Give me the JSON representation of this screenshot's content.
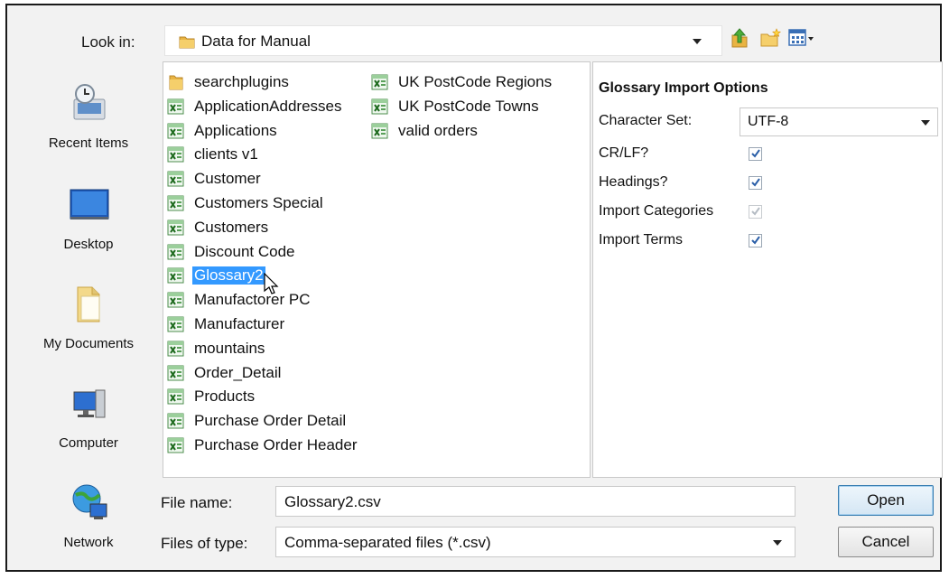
{
  "lookin": {
    "label": "Look in:",
    "value": "Data for Manual"
  },
  "toolbar": {
    "up_icon": "up-folder-icon",
    "new_icon": "new-folder-icon",
    "view_icon": "view-menu-icon"
  },
  "places": [
    {
      "label": "Recent Items",
      "icon": "recent-items-icon"
    },
    {
      "label": "Desktop",
      "icon": "desktop-icon"
    },
    {
      "label": "My Documents",
      "icon": "my-documents-icon"
    },
    {
      "label": "Computer",
      "icon": "computer-icon"
    },
    {
      "label": "Network",
      "icon": "network-icon"
    }
  ],
  "files": {
    "column1": [
      {
        "name": "searchplugins",
        "type": "folder"
      },
      {
        "name": "ApplicationAddresses",
        "type": "csv"
      },
      {
        "name": "Applications",
        "type": "csv"
      },
      {
        "name": "clients v1",
        "type": "csv"
      },
      {
        "name": "Customer",
        "type": "csv"
      },
      {
        "name": "Customers Special",
        "type": "csv"
      },
      {
        "name": "Customers",
        "type": "csv"
      },
      {
        "name": "Discount Code",
        "type": "csv"
      },
      {
        "name": "Glossary2",
        "type": "csv",
        "selected": true
      },
      {
        "name": "Manufactorer PC",
        "type": "csv"
      },
      {
        "name": "Manufacturer",
        "type": "csv"
      },
      {
        "name": "mountains",
        "type": "csv"
      },
      {
        "name": "Order_Detail",
        "type": "csv"
      },
      {
        "name": "Products",
        "type": "csv"
      },
      {
        "name": "Purchase Order Detail",
        "type": "csv"
      },
      {
        "name": "Purchase Order Header",
        "type": "csv"
      }
    ],
    "column2": [
      {
        "name": "UK PostCode Regions",
        "type": "csv"
      },
      {
        "name": "UK PostCode Towns",
        "type": "csv"
      },
      {
        "name": "valid orders",
        "type": "csv"
      }
    ]
  },
  "options": {
    "title": "Glossary Import Options",
    "charset_label": "Character Set:",
    "charset_value": "UTF-8",
    "crlf_label": "CR/LF?",
    "crlf_checked": true,
    "headings_label": "Headings?",
    "headings_checked": true,
    "categories_label": "Import Categories",
    "categories_checked": true,
    "categories_disabled": true,
    "terms_label": "Import Terms",
    "terms_checked": true
  },
  "filename": {
    "label": "File name:",
    "value": "Glossary2.csv"
  },
  "filetype": {
    "label": "Files of type:",
    "value": "Comma-separated files (*.csv)"
  },
  "buttons": {
    "open": "Open",
    "cancel": "Cancel"
  },
  "colors": {
    "selection": "#3399ff",
    "check": "#2b5fa8"
  }
}
